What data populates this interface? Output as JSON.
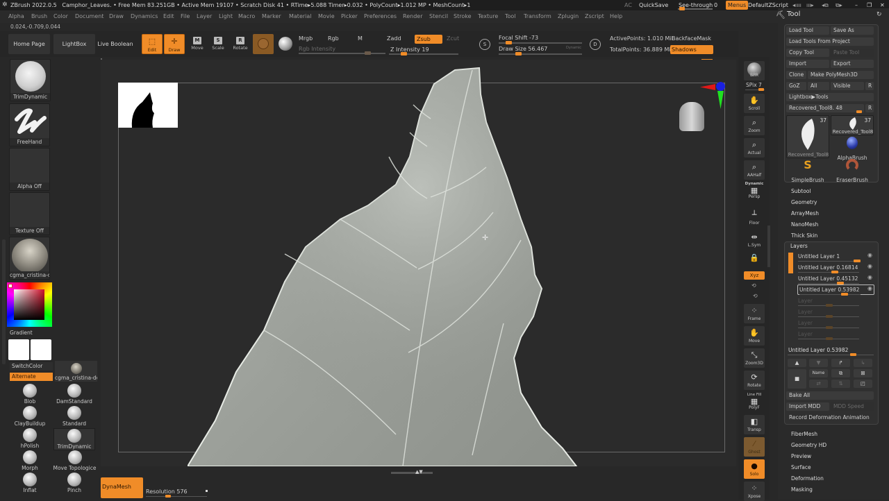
{
  "titlebar": {
    "app": "ZBrush 2022.0.5",
    "document": "Camphor_Leaves",
    "stats": ". • Free Mem 83.251GB • Active Mem 19107 • Scratch Disk 41 •  RTime▸5.088 Timer▸0.032 • PolyCount▸1.012 MP  • MeshCount▸1",
    "ac": "AC",
    "quicksave": "QuickSave",
    "seethrough_label": "See-through",
    "seethrough_value": "0",
    "menus": "Menus",
    "script": "DefaultZScript",
    "window_icons": [
      "◂ıııı",
      "ııı▸",
      "◂⧉",
      "⧉▸"
    ],
    "minimize": "–",
    "restore": "❐",
    "close": "✕"
  },
  "menubar": [
    "Alpha",
    "Brush",
    "Color",
    "Document",
    "Draw",
    "Dynamics",
    "Edit",
    "File",
    "Layer",
    "Light",
    "Macro",
    "Marker",
    "Material",
    "Movie",
    "Picker",
    "Preferences",
    "Render",
    "Stencil",
    "Stroke",
    "Texture",
    "Tool",
    "Transform",
    "Zplugin",
    "Zscript",
    "Help"
  ],
  "coords": "0.024,-0.709,0.044",
  "toolbar": {
    "home_page": "Home Page",
    "lightbox": "LightBox",
    "live_boolean": "Live Boolean",
    "edit": "Edit",
    "draw": "Draw",
    "move": "Move",
    "scale": "Scale",
    "rotate": "Rotate",
    "mrgb": "Mrgb",
    "rgb": "Rgb",
    "m": "M",
    "rgb_intensity": "Rgb Intensity",
    "zadd": "Zadd",
    "zsub": "Zsub",
    "zcut": "Zcut",
    "z_intensity_label": "Z Intensity",
    "z_intensity_value": "19",
    "focal_shift_label": "Focal Shift",
    "focal_shift_value": "-73",
    "draw_size_label": "Draw Size",
    "draw_size_value": "56.467",
    "dynamic": "Dynamic",
    "active_points": "ActivePoints: 1.010 Mil",
    "total_points": "TotalPoints: 36.889 Mil",
    "backface_mask": "BackfaceMask",
    "shadows": "Shadows"
  },
  "leftshelf": {
    "brush_thumb": "TrimDynamic",
    "stroke_thumb": "FreeHand",
    "alpha_thumb": "Alpha Off",
    "texture_thumb": "Texture Off",
    "material_thumb": "cgma_cristina-dc",
    "gradient": "Gradient",
    "switch_color": "SwitchColor",
    "alternate": "Alternate",
    "material_small": "cgma_cristina-dc",
    "brushes": [
      "Blob",
      "DamStandard",
      "ClayBuildup",
      "Standard",
      "hPolish",
      "TrimDynamic",
      "Morph",
      "Move Topologice",
      "Inflat",
      "Pinch"
    ]
  },
  "bottom": {
    "dynamesh": "DynaMesh",
    "resolution_label": "Resolution",
    "resolution_value": "576"
  },
  "rightcol": {
    "bpr": "BPR",
    "spix_label": "SPix",
    "spix_value": "7",
    "buttons": [
      "Scroll",
      "Zoom",
      "Actual",
      "AAHalf",
      "Persp",
      "Floor",
      "L.Sym",
      "",
      "Xyz",
      "Frame",
      "Move",
      "Zoom3D",
      "Rotate",
      "PolyF",
      "Transp",
      "Ghost",
      "Solo",
      "Xpose"
    ],
    "dynamic": "Dynamic",
    "line_fill": "Line Fill"
  },
  "toolpanel": {
    "title": "Tool",
    "load_tool": "Load Tool",
    "save_as": "Save As",
    "load_from_project": "Load Tools From Project",
    "copy_tool": "Copy Tool",
    "paste_tool": "Paste Tool",
    "import": "Import",
    "export": "Export",
    "clone": "Clone",
    "make_polymesh": "Make PolyMesh3D",
    "goz": "GoZ",
    "all": "All",
    "visible": "Visible",
    "r": "R",
    "lightbox_tools": "Lightbox▶Tools",
    "current_tool": "Recovered_Tool8. 48",
    "tools": [
      {
        "name": "Recovered_Tool8",
        "count": "37"
      },
      {
        "name": "Recovered_Tool8",
        "count": "37"
      },
      {
        "name": "AlphaBrush"
      },
      {
        "name": "SimpleBrush"
      },
      {
        "name": "EraserBrush"
      }
    ],
    "sections_top": [
      "Subtool",
      "Geometry",
      "ArrayMesh",
      "NanoMesh",
      "Thick Skin"
    ],
    "layers_title": "Layers",
    "layers": [
      {
        "name": "Untitled Layer 1",
        "value": 1.0
      },
      {
        "name": "Untitled Layer 0.16814",
        "value": 0.16814
      },
      {
        "name": "Untitled Layer 0.45132",
        "value": 0.45132
      },
      {
        "name": "Untitled Layer 0.53982",
        "value": 0.53982
      },
      {
        "name": "Layer"
      },
      {
        "name": "Layer"
      },
      {
        "name": "Layer"
      },
      {
        "name": "Layer"
      }
    ],
    "selected_layer": "Untitled Layer 0.53982",
    "name_btn": "Name",
    "bake_all": "Bake All",
    "import_mdd": "Import MDD",
    "mdd_speed": "MDD Speed",
    "record_deformation": "Record Deformation Animation",
    "sections_bottom": [
      "FiberMesh",
      "Geometry HD",
      "Preview",
      "Surface",
      "Deformation",
      "Masking"
    ]
  },
  "colors": {
    "accent": "#f08c28",
    "background": "#282828",
    "panel": "#2a2a2a"
  }
}
